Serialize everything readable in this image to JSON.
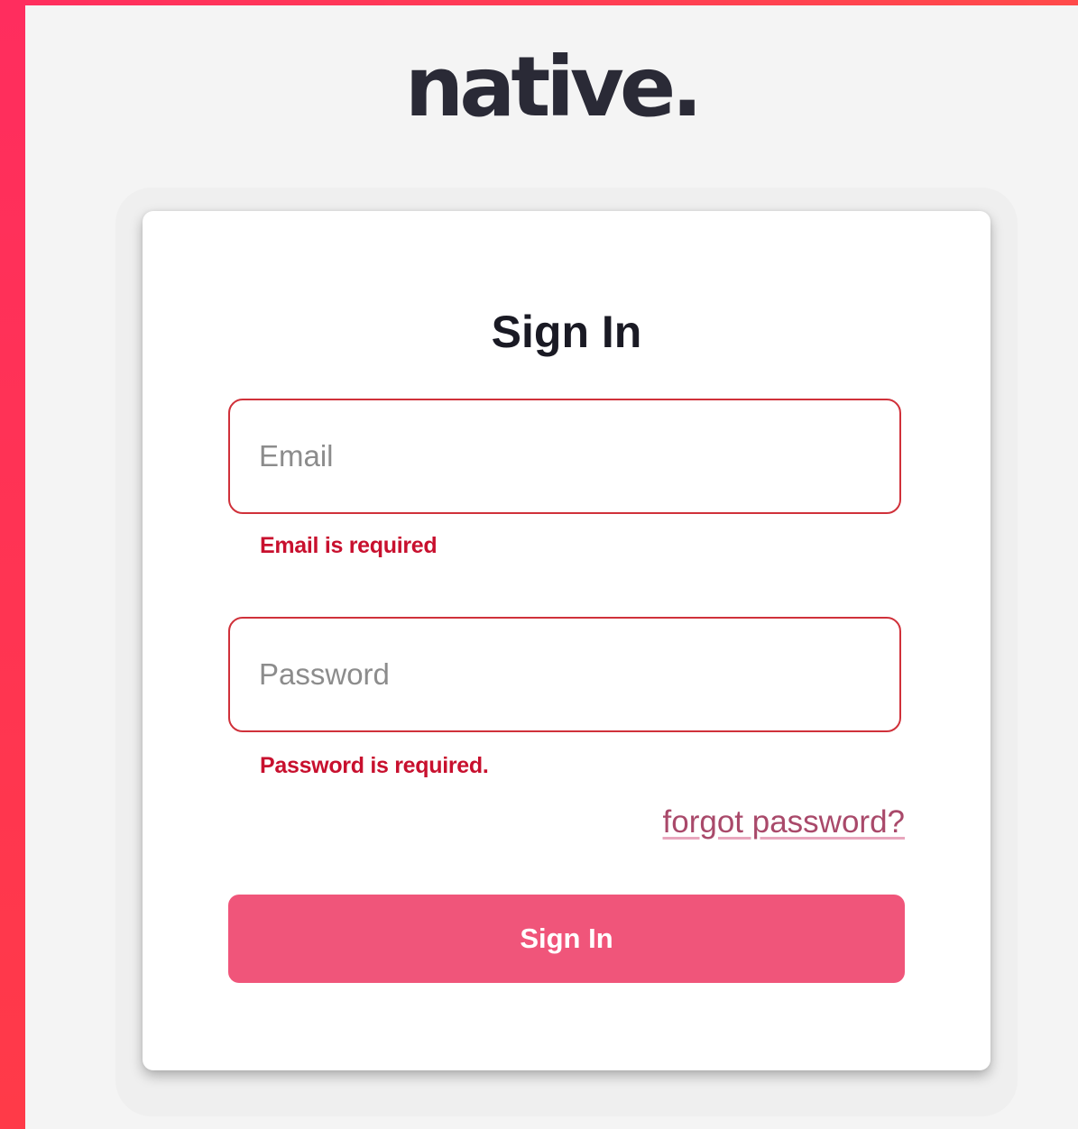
{
  "brand": {
    "logo_text": "native.",
    "accent_color": "#f0557a",
    "frame_color": "#ff2d5e",
    "error_color": "#c8102e"
  },
  "form": {
    "title": "Sign In",
    "email": {
      "placeholder": "Email",
      "value": "",
      "error": "Email is required"
    },
    "password": {
      "placeholder": "Password",
      "value": "",
      "error": "Password is required."
    },
    "forgot_link": "forgot password?",
    "submit_label": "Sign In"
  }
}
